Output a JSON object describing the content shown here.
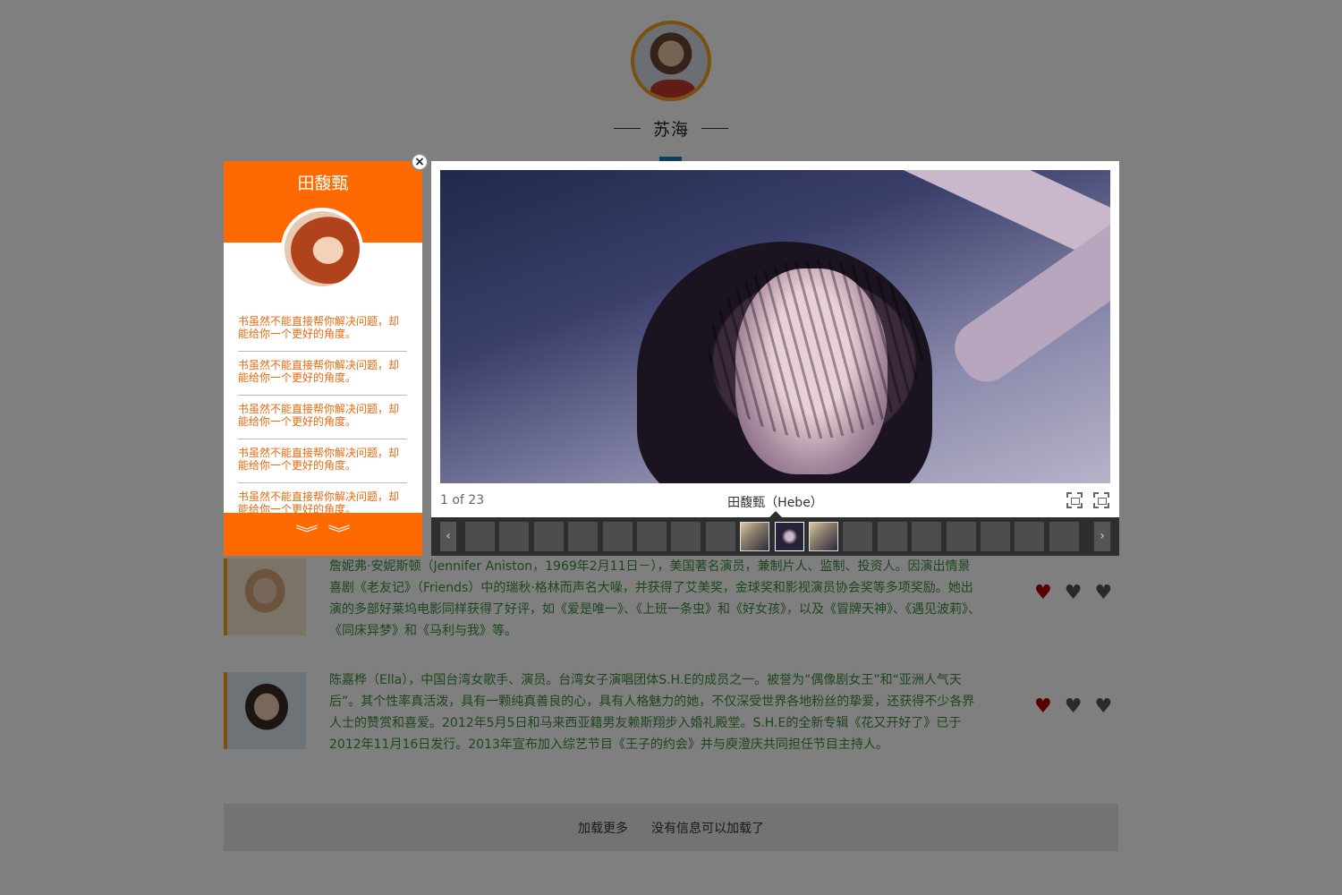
{
  "profile": {
    "name": "苏海"
  },
  "posts": [
    {
      "text": "詹妮弗·安妮斯顿（Jennifer Aniston，1969年2月11日－），美国著名演员，兼制片人、监制、投资人。因演出情景喜剧《老友记》（Friends）中的瑞秋·格林而声名大噪，并获得了艾美奖，金球奖和影视演员协会奖等多项奖励。她出演的多部好莱坞电影同样获得了好评，如《爱是唯一》、《上班一条虫》和《好女孩》，以及《冒牌天神》、《遇见波莉》、《同床异梦》和《马利与我》等。",
      "like_icon": "heart-icon",
      "neutral_icon": "heart-icon",
      "broken_icon": "broken-heart-icon"
    },
    {
      "text": "陈嘉桦（Ella），中国台湾女歌手、演员。台湾女子演唱团体S.H.E的成员之一。被誉为“偶像剧女王”和“亚洲人气天后”。其个性率真活泼，具有一颗纯真善良的心，具有人格魅力的她，不仅深受世界各地粉丝的挚爱，还获得不少各界人士的赞赏和喜爱。2012年5月5日和马来西亚籍男友赖斯翔步入婚礼殿堂。S.H.E的全新专辑《花又开好了》已于2012年11月16日发行。2013年宣布加入综艺节目《王子的约会》并与庾澄庆共同担任节目主持人。",
      "like_icon": "heart-icon",
      "neutral_icon": "heart-icon",
      "broken_icon": "broken-heart-icon"
    }
  ],
  "load_more": {
    "label": "加载更多",
    "status": "没有信息可以加载了"
  },
  "side_panel": {
    "title": "田馥甄",
    "items": [
      "书虽然不能直接帮你解决问题，却能给你一个更好的角度。",
      "书虽然不能直接帮你解决问题，却能给你一个更好的角度。",
      "书虽然不能直接帮你解决问题，却能给你一个更好的角度。",
      "书虽然不能直接帮你解决问题，却能给你一个更好的角度。",
      "书虽然不能直接帮你解决问题，却能给你一个更好的角度。"
    ],
    "footer_icon": "double-chevron-down-icon"
  },
  "lightbox": {
    "counter": "1 of 23",
    "caption": "田馥甄（Hebe）",
    "close_glyph": "×",
    "prev_glyph": "‹",
    "next_glyph": "›",
    "thumbnails_total": 18,
    "current_thumbnail": 9
  },
  "colors": {
    "accent": "#ff6a00",
    "text_green": "#3d8d3d",
    "overlay": "rgba(0,0,0,0.5)",
    "heart_red": "#b30000"
  }
}
